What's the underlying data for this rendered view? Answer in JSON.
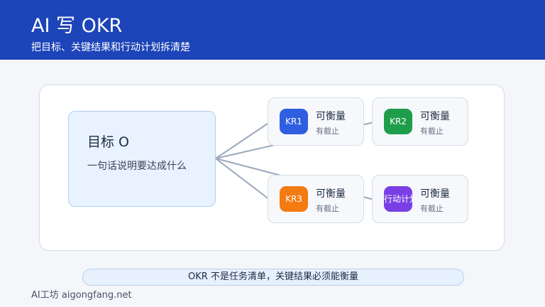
{
  "header": {
    "title": "AI 写 OKR",
    "subtitle": "把目标、关键结果和行动计划拆清楚"
  },
  "objective": {
    "title": "目标 O",
    "description": "一句话说明要达成什么"
  },
  "key_results": [
    {
      "badge": "KR1",
      "label": "可衡量",
      "sublabel": "有截止",
      "color": "#2f5fe0"
    },
    {
      "badge": "KR2",
      "label": "可衡量",
      "sublabel": "有截止",
      "color": "#1e9e4a"
    },
    {
      "badge": "KR3",
      "label": "可衡量",
      "sublabel": "有截止",
      "color": "#f47a12"
    },
    {
      "badge": "行动计划",
      "label": "可衡量",
      "sublabel": "有截止",
      "color": "#7a3fe4"
    }
  ],
  "footer": {
    "note": "OKR 不是任务清单，关键结果必须能衡量",
    "brand": "AI工坊 aigongfang.net"
  }
}
